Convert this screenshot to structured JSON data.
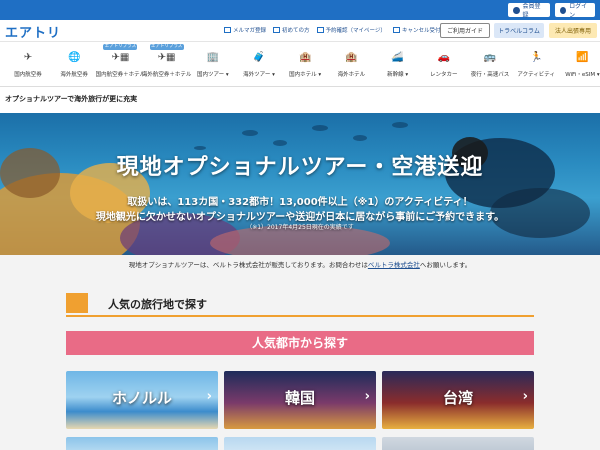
{
  "topbar": {
    "register": "会員登録",
    "login": "ログイン"
  },
  "header": {
    "logo": "エアトリ",
    "links": [
      "メルマガ登録",
      "初めての方",
      "予約確認（マイページ）",
      "キャンセル受付"
    ],
    "buttons": [
      "ご利用ガイド",
      "トラベルコラム",
      "法人出張専用"
    ]
  },
  "nav": {
    "badge": "エアトリプラス",
    "items": [
      {
        "label": "国内航空券",
        "icon": "✈"
      },
      {
        "label": "海外航空券",
        "icon": "🌐"
      },
      {
        "label": "国内航空券＋ホテル",
        "icon": "✈▦"
      },
      {
        "label": "海外航空券＋ホテル",
        "icon": "✈▦"
      },
      {
        "label": "国内ツアー ▾",
        "icon": "🏢"
      },
      {
        "label": "海外ツアー ▾",
        "icon": "🧳"
      },
      {
        "label": "国内ホテル ▾",
        "icon": "🏨"
      },
      {
        "label": "海外ホテル",
        "icon": "🏨"
      },
      {
        "label": "新幹線 ▾",
        "icon": "🚄"
      },
      {
        "label": "レンタカー",
        "icon": "🚗"
      },
      {
        "label": "夜行・高速バス",
        "icon": "🚌"
      },
      {
        "label": "アクティビティ",
        "icon": "🏃"
      },
      {
        "label": "WiFi・eSIM ▾",
        "icon": "📶"
      }
    ]
  },
  "subtitle": "オプショナルツアーで海外旅行が更に充実",
  "hero": {
    "title": "現地オプショナルツアー・空港送迎",
    "line1": "取扱いは、113カ国・332都市！13,000件以上（※1）のアクティビティ！",
    "line2": "現地観光に欠かせないオプショナルツアーや送迎が日本に居ながら事前にご予約できます。",
    "note": "（※1）2017年4月25日現在の実績です"
  },
  "notice": {
    "before": "現地オプショナルツアーは、ベルトラ株式会社が販売しております。お問合わせは",
    "link": "ベルトラ株式会社",
    "after": "へお願いします。"
  },
  "section": {
    "title": "人気の旅行地で探す",
    "band": "人気都市から探す"
  },
  "cities": [
    "ホノルル",
    "韓国",
    "台湾"
  ]
}
